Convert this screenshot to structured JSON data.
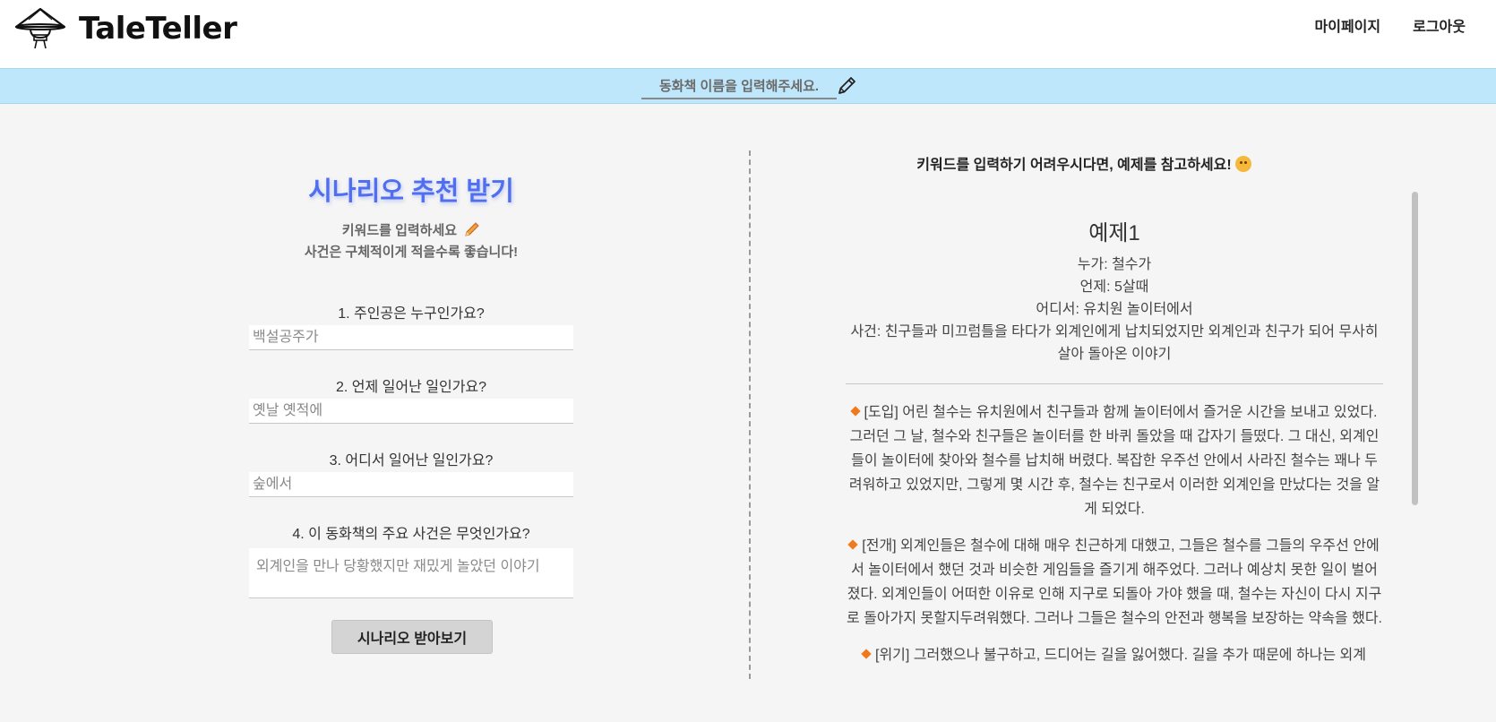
{
  "header": {
    "logo_text": "TaleTeller",
    "nav": {
      "mypage": "마이페이지",
      "logout": "로그아웃"
    }
  },
  "title_bar": {
    "placeholder": "동화책 이름을 입력해주세요.",
    "edit_icon": "pencil-icon"
  },
  "left_panel": {
    "title": "시나리오 추천 받기",
    "subtitle_line1": "키워드를 입력하세요",
    "subtitle_line2": "사건은 구체적이게 적을수록 좋습니다!",
    "questions": [
      {
        "label": "1. 주인공은 누구인가요?",
        "placeholder": "백설공주가"
      },
      {
        "label": "2. 언제 일어난 일인가요?",
        "placeholder": "옛날 옛적에"
      },
      {
        "label": "3. 어디서 일어난 일인가요?",
        "placeholder": "숲에서"
      },
      {
        "label": "4. 이 동화책의 주요 사건은 무엇인가요?",
        "placeholder": "외계인을 만나 당황했지만 재밌게 놀았던 이야기"
      }
    ],
    "submit_label": "시나리오 받아보기"
  },
  "right_panel": {
    "heading": "키워드를 입력하기 어려우시다면, 예제를 참고하세요!",
    "example": {
      "title": "예제1",
      "who": "누가: 철수가",
      "when": "언제: 5살때",
      "where": "어디서: 유치원 놀이터에서",
      "event": "사건: 친구들과 미끄럼틀을 타다가 외계인에게 납치되었지만 외계인과 친구가 되어 무사히 살아 돌아온 이야기",
      "paragraphs": [
        "[도입] 어린 철수는 유치원에서 친구들과 함께 놀이터에서 즐거운 시간을 보내고 있었다. 그러던 그 날, 철수와 친구들은 놀이터를 한 바퀴 돌았을 때 갑자기 들떴다. 그 대신, 외계인들이 놀이터에 찾아와 철수를 납치해 버렸다. 복잡한 우주선 안에서 사라진 철수는 꽤나 두려워하고 있었지만, 그렇게 몇 시간 후, 철수는 친구로서 이러한 외계인을 만났다는 것을 알게 되었다.",
        "[전개] 외계인들은 철수에 대해 매우 친근하게 대했고, 그들은 철수를 그들의 우주선 안에서 놀이터에서 했던 것과 비슷한 게임들을 즐기게 해주었다. 그러나 예상치 못한 일이 벌어졌다. 외계인들이 어떠한 이유로 인해 지구로 되돌아 가야 했을 때, 철수는 자신이 다시 지구로 돌아가지 못할지두려워했다. 그러나 그들은 철수의 안전과 행복을 보장하는 약속을 했다.",
        "[위기] 그러했으나 불구하고, 드디어는 길을 잃어했다. 길을 추가 때문에 하나는 외계"
      ]
    }
  },
  "colors": {
    "accent_title": "#4f6ff0",
    "title_bar_bg": "#bfe7fb",
    "diamond": "#f07a1b"
  }
}
